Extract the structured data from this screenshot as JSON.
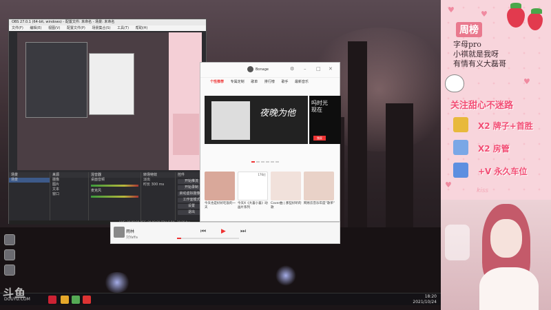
{
  "obs": {
    "title": "OBS 27.0.1 (64-bit, windows) - 配置文件: 未命名 - 场景: 未命名",
    "menu": [
      "文件(F)",
      "编辑(E)",
      "视图(V)",
      "配置文件(P)",
      "场景集合(S)",
      "工具(T)",
      "帮助(H)"
    ],
    "docks": {
      "scenes_header": "场景",
      "sources_header": "来源",
      "mixer_header": "混音器",
      "transitions_header": "转场特效",
      "controls_header": "控件"
    },
    "sources": [
      "摄像",
      "图片",
      "文本",
      "窗口"
    ],
    "mixer": [
      "桌面音频",
      "麦克风"
    ],
    "transition": {
      "type": "淡出",
      "duration_label": "时长",
      "duration_value": "300 ms"
    },
    "controls": [
      "开始推流",
      "开始录制",
      "启动虚拟摄像机",
      "工作室模式",
      "设置",
      "退出"
    ],
    "status": "LIVE: 00:00:00  REC: 00:00:00  CPU: 5.5%, 30.00 fps"
  },
  "player": {
    "user": "Bonage",
    "nav": [
      "个性推荐",
      "专属定制",
      "歌单",
      "排行榜",
      "歌手",
      "最新音乐"
    ],
    "banner_title": "夜晚为他",
    "banner_side": "吗时光\n现在",
    "banner_tag": "独家",
    "cards": [
      {
        "caption": "今天也是好好吃饭的一天",
        "play": "",
        "color": "#d9a89a"
      },
      {
        "caption": "今天X《大喜小喜》动画片系列",
        "play": "176亿",
        "color": "#ffffff"
      },
      {
        "caption": "Cover曲 | 那些好听的歌",
        "play": "",
        "color": "#f1e1db"
      },
      {
        "caption": "网易云音乐年度“歌单”",
        "play": "",
        "color": "#e9d2c8"
      }
    ],
    "now_playing": {
      "song": "雨林",
      "artist": "刘Yaffa"
    }
  },
  "taskbar": {
    "time": "18:20",
    "date": "2021/10/24"
  },
  "watermark": {
    "logo": "斗鱼",
    "url": "DOUYU.COM"
  },
  "panel": {
    "rank_title": "周榜",
    "rank_names": [
      "字母pro",
      "小祺就是我呀",
      "有情有义大磊哥"
    ],
    "follow_text": "关注甜心不迷路",
    "gifts": [
      {
        "text": "X2 牌子+首胜",
        "icon": "gold-bar-icon",
        "color": "#e8b93c"
      },
      {
        "text": "X2 房管",
        "icon": "rocket-icon",
        "color": "#7aa7e6"
      },
      {
        "text": "+V 永久车位",
        "icon": "rocket-icon",
        "color": "#5d8fe0"
      }
    ],
    "kiss": "kiss"
  },
  "colors": {
    "accent": "#f24d74",
    "panel_bg": "#f8d5dc",
    "player_accent": "#e33333"
  }
}
